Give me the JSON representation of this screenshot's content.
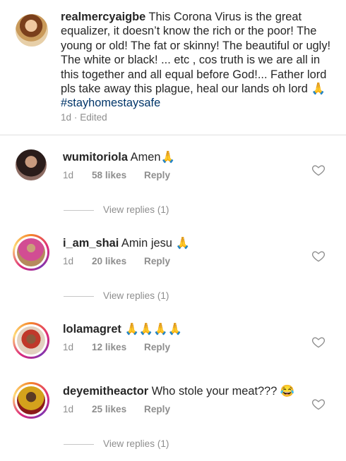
{
  "caption": {
    "username": "realmercyaigbe",
    "text": " This Corona Virus is the great equalizer, it doesn’t know the rich or the poor! The young or old! The fat or skinny! The beautiful or ugly! The white or black! ... etc , cos truth is we are all in this together and all equal before God!... Father lord pls take away this plague, heal our lands oh lord 🙏 ",
    "hashtag": "#stayhomestaysafe",
    "meta": "1d · Edited"
  },
  "comments": [
    {
      "username": "wumitoriola",
      "text": " Amen🙏",
      "time": "1d",
      "likes": "58 likes",
      "reply": "Reply",
      "avatar_color": "#3a2a28",
      "story_ring": false
    },
    {
      "username": "i_am_shai",
      "text": " Amin jesu 🙏",
      "time": "1d",
      "likes": "20 likes",
      "reply": "Reply",
      "avatar_color": "#c2458a",
      "story_ring": true
    },
    {
      "username": "lolamagret",
      "text": " 🙏🙏🙏🙏",
      "time": "1d",
      "likes": "12 likes",
      "reply": "Reply",
      "avatar_color": "#b23a2e",
      "story_ring": true
    },
    {
      "username": "deyemitheactor",
      "text": " Who stole your meat??? 😂",
      "time": "1d",
      "likes": "25 likes",
      "reply": "Reply",
      "avatar_color": "#c8961e",
      "story_ring": true
    }
  ],
  "view_replies": [
    {
      "label": "View replies (1)"
    },
    {
      "label": "View replies (1)"
    },
    {
      "label": "View replies (1)"
    }
  ],
  "icons": {
    "like": "heart-outline-icon"
  }
}
